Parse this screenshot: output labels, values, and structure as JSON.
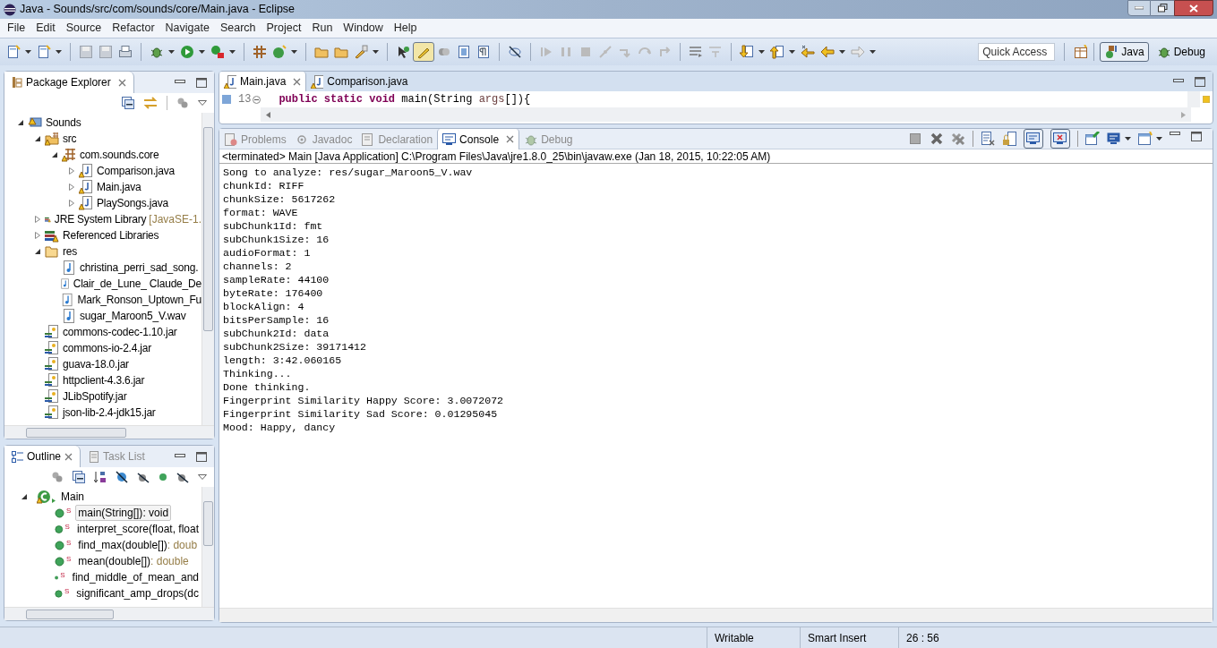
{
  "window": {
    "title": "Java - Sounds/src/com/sounds/core/Main.java - Eclipse"
  },
  "menu": [
    "File",
    "Edit",
    "Source",
    "Refactor",
    "Navigate",
    "Search",
    "Project",
    "Run",
    "Window",
    "Help"
  ],
  "quick_access": {
    "placeholder": "Quick Access"
  },
  "perspectives": [
    {
      "label": "Java",
      "selected": true
    },
    {
      "label": "Debug",
      "selected": false
    }
  ],
  "package_explorer": {
    "title": "Package Explorer",
    "tree": [
      {
        "label": "Sounds",
        "kind": "project",
        "expanded": true,
        "children": [
          {
            "label": "src",
            "kind": "source",
            "expanded": true,
            "children": [
              {
                "label": "com.sounds.core",
                "kind": "package",
                "expanded": true,
                "children": [
                  {
                    "label": "Comparison.java",
                    "kind": "java",
                    "expanded": false
                  },
                  {
                    "label": "Main.java",
                    "kind": "java",
                    "expanded": false
                  },
                  {
                    "label": "PlaySongs.java",
                    "kind": "java",
                    "expanded": false
                  }
                ]
              }
            ]
          },
          {
            "label": "JRE System Library",
            "suffix": "[JavaSE-1.",
            "kind": "library",
            "expanded": false
          },
          {
            "label": "Referenced Libraries",
            "kind": "library",
            "expanded": false
          },
          {
            "label": "res",
            "kind": "folder",
            "expanded": true,
            "children": [
              {
                "label": "christina_perri_sad_song.",
                "kind": "audio"
              },
              {
                "label": "Clair_de_Lune_ Claude_De",
                "kind": "audio"
              },
              {
                "label": "Mark_Ronson_Uptown_Fu",
                "kind": "audio"
              },
              {
                "label": "sugar_Maroon5_V.wav",
                "kind": "audio"
              }
            ]
          },
          {
            "label": "commons-codec-1.10.jar",
            "kind": "jar"
          },
          {
            "label": "commons-io-2.4.jar",
            "kind": "jar"
          },
          {
            "label": "guava-18.0.jar",
            "kind": "jar"
          },
          {
            "label": "httpclient-4.3.6.jar",
            "kind": "jar"
          },
          {
            "label": "JLibSpotify.jar",
            "kind": "jar"
          },
          {
            "label": "json-lib-2.4-jdk15.jar",
            "kind": "jar"
          }
        ]
      }
    ]
  },
  "outline": {
    "tabs": [
      {
        "label": "Outline",
        "selected": true
      },
      {
        "label": "Task List",
        "selected": false
      }
    ],
    "tree": [
      {
        "label": "Main",
        "expanded": true,
        "selected": false,
        "children": [
          {
            "modifier": "S",
            "label": "main(String[])",
            "type": " : void",
            "selected": true
          },
          {
            "modifier": "S",
            "label": "interpret_score(float, float",
            "selected": false
          },
          {
            "modifier": "S",
            "label": "find_max(double[])",
            "type": " : doub",
            "selected": false
          },
          {
            "modifier": "S",
            "label": "mean(double[])",
            "type": " : double",
            "selected": false
          },
          {
            "modifier": "S",
            "label": "find_middle_of_mean_and",
            "selected": false
          },
          {
            "modifier": "S",
            "label": "significant_amp_drops(dc",
            "selected": false
          }
        ]
      }
    ]
  },
  "editor": {
    "tabs": [
      {
        "label": "Main.java",
        "selected": true
      },
      {
        "label": "Comparison.java",
        "selected": false
      }
    ],
    "line_number": "13",
    "code": [
      {
        "text": "public static void",
        "kind": "keyword"
      },
      {
        "text": " main(String ",
        "kind": "plain"
      },
      {
        "text": "args",
        "kind": "param"
      },
      {
        "text": "[]){",
        "kind": "plain"
      }
    ]
  },
  "bottom_tabs": [
    {
      "label": "Problems",
      "selected": false
    },
    {
      "label": "Javadoc",
      "selected": false
    },
    {
      "label": "Declaration",
      "selected": false
    },
    {
      "label": "Console",
      "selected": true
    },
    {
      "label": "Debug",
      "selected": false
    }
  ],
  "console": {
    "header": "<terminated> Main [Java Application] C:\\Program Files\\Java\\jre1.8.0_25\\bin\\javaw.exe (Jan 18, 2015, 10:22:05 AM)",
    "lines": [
      "Song to analyze: res/sugar_Maroon5_V.wav",
      "chunkId: RIFF",
      "chunkSize: 5617262",
      "format: WAVE",
      "subChunk1Id: fmt",
      "subChunk1Size: 16",
      "audioFormat: 1",
      "channels: 2",
      "sampleRate: 44100",
      "byteRate: 176400",
      "blockAlign: 4",
      "bitsPerSample: 16",
      "subChunk2Id: data",
      "subChunk2Size: 39171412",
      "length: 3:42.060165",
      "Thinking...",
      "Done thinking.",
      "Fingerprint Similarity Happy Score: 3.0072072",
      "Fingerprint Similarity Sad Score: 0.01295045",
      "Mood: Happy, dancy"
    ]
  },
  "status_bar": [
    "Writable",
    "Smart Insert",
    "26 : 56"
  ]
}
